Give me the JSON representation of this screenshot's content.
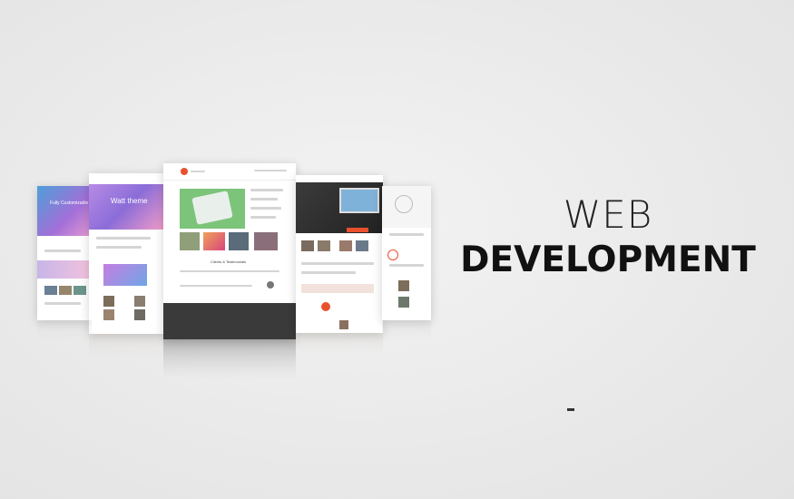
{
  "headline": {
    "line1": "WEB",
    "line2": "DEVELOPMENT"
  },
  "colors": {
    "background": "#ececec",
    "accent": "#e8502e",
    "dark_footer": "#3a3a3a",
    "green_hero": "#7cc47a",
    "purple_hero": "#8a6fd6",
    "text": "#111111"
  },
  "mockups": {
    "far_left": {
      "hero_title": "Fully Customizable"
    },
    "left": {
      "hero_title": "Watt theme"
    },
    "center": {
      "section_title": "Clients & Testimonials"
    },
    "right": {},
    "far_right": {}
  }
}
